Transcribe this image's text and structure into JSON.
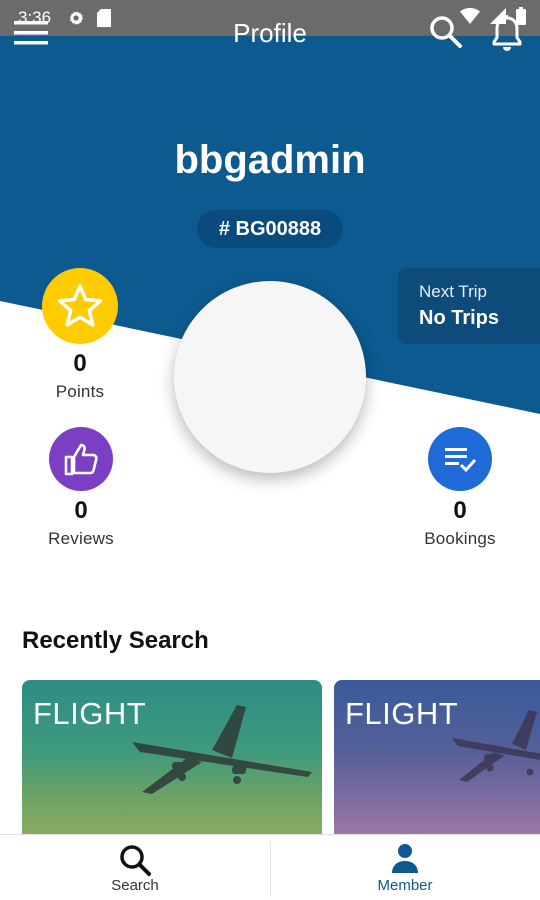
{
  "status_bar": {
    "time": "3:36",
    "icons": [
      "gear-icon",
      "sd-card-icon",
      "wifi-icon",
      "signal-icon",
      "battery-icon"
    ]
  },
  "app_bar": {
    "title": "Profile",
    "icons": [
      "menu-icon",
      "search-icon",
      "bell-icon"
    ]
  },
  "profile": {
    "username": "bbgadmin",
    "member_id": "# BG00888"
  },
  "next_trip": {
    "label": "Next Trip",
    "value": "No Trips"
  },
  "stats": {
    "points": {
      "count": "0",
      "label": "Points",
      "icon": "star-icon",
      "color": "#ffcc00"
    },
    "reviews": {
      "count": "0",
      "label": "Reviews",
      "icon": "thumbs-up-icon",
      "color": "#7b3fc4"
    },
    "bookings": {
      "count": "0",
      "label": "Bookings",
      "icon": "checklist-icon",
      "color": "#1e6ad6"
    }
  },
  "recent": {
    "title": "Recently Search",
    "cards": [
      {
        "label": "FLIGHT"
      },
      {
        "label": "FLIGHT"
      }
    ]
  },
  "bottom_nav": {
    "items": [
      {
        "label": "Search",
        "icon": "search-icon"
      },
      {
        "label": "Member",
        "icon": "person-icon"
      }
    ],
    "active": "Member"
  },
  "colors": {
    "primary": "#0d5a91",
    "status_bar": "#6b6b6b",
    "active_nav": "#0d5a91"
  }
}
